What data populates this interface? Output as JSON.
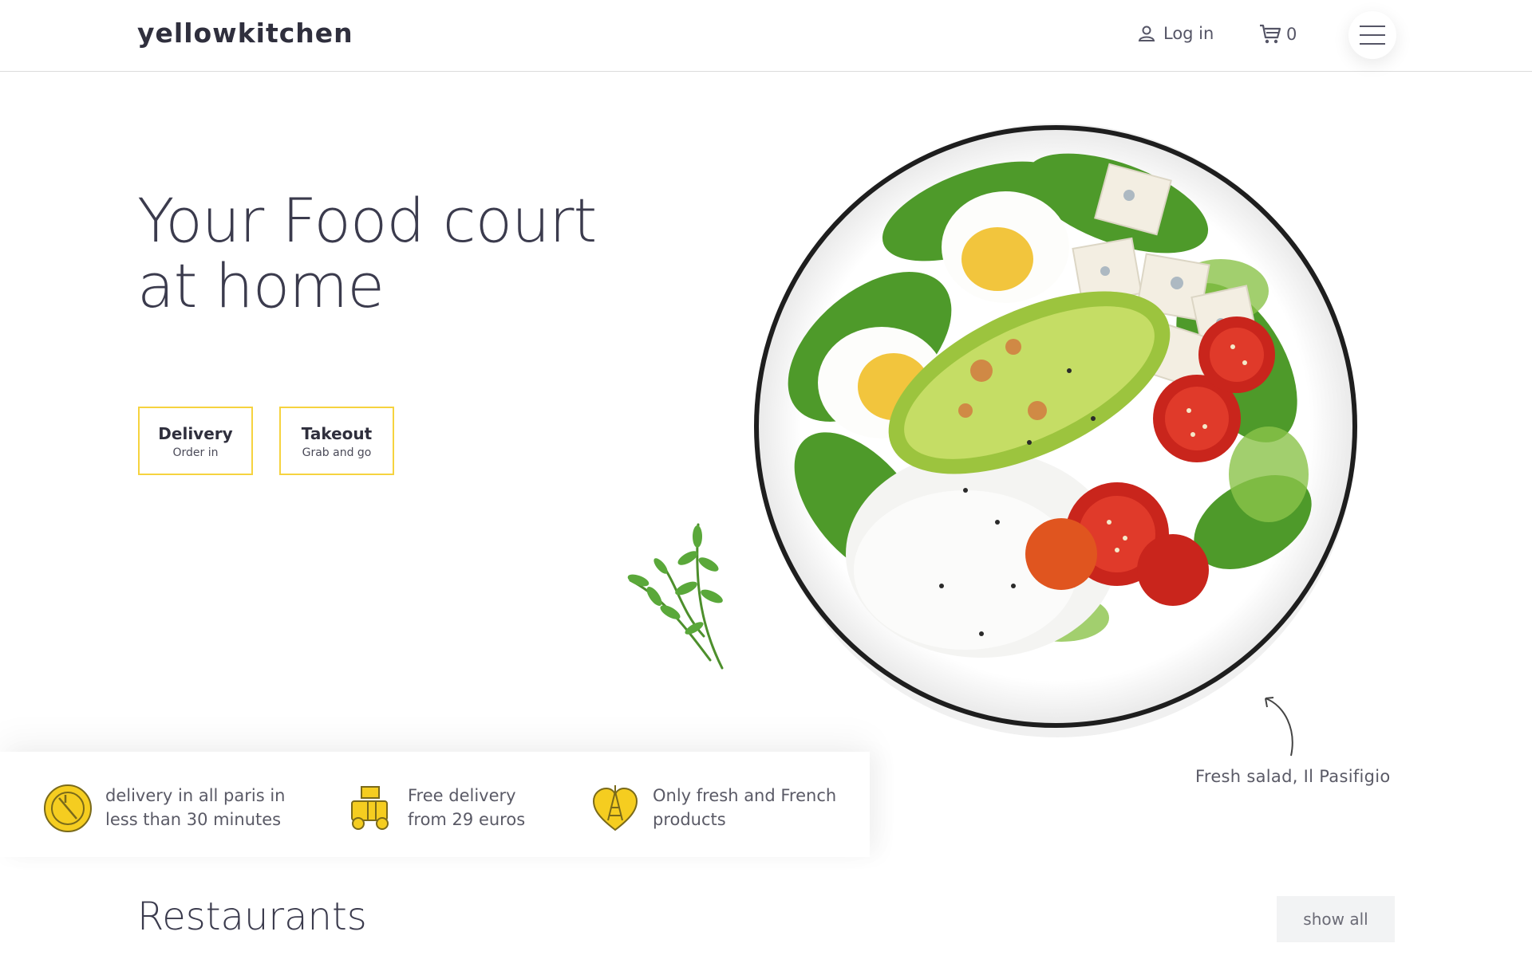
{
  "header": {
    "logo_highlight": "yellow",
    "logo_rest": "kitchen",
    "login_label": "Log in",
    "cart_count": "0",
    "menu_icon": "hamburger-icon"
  },
  "hero": {
    "title_line1": "Your Food court",
    "title_line2": "at home",
    "buttons": [
      {
        "label": "Delivery",
        "sublabel": "Order in"
      },
      {
        "label": "Takeout",
        "sublabel": "Grab and go"
      }
    ],
    "image_caption": "Fresh salad, Il Pasifigio"
  },
  "features": [
    {
      "icon": "clock-plate-icon",
      "line1": "delivery in all paris in",
      "line2": "less than 30 minutes"
    },
    {
      "icon": "delivery-scooter-icon",
      "line1": "Free delivery",
      "line2": "from 29 euros"
    },
    {
      "icon": "eiffel-heart-icon",
      "line1": "Only fresh and French",
      "line2": "products"
    }
  ],
  "restaurants": {
    "title": "Restaurants",
    "show_all_label": "show all"
  },
  "colors": {
    "accent": "#ffd21f",
    "text": "#3b3b4d",
    "border": "#f6d33f"
  }
}
